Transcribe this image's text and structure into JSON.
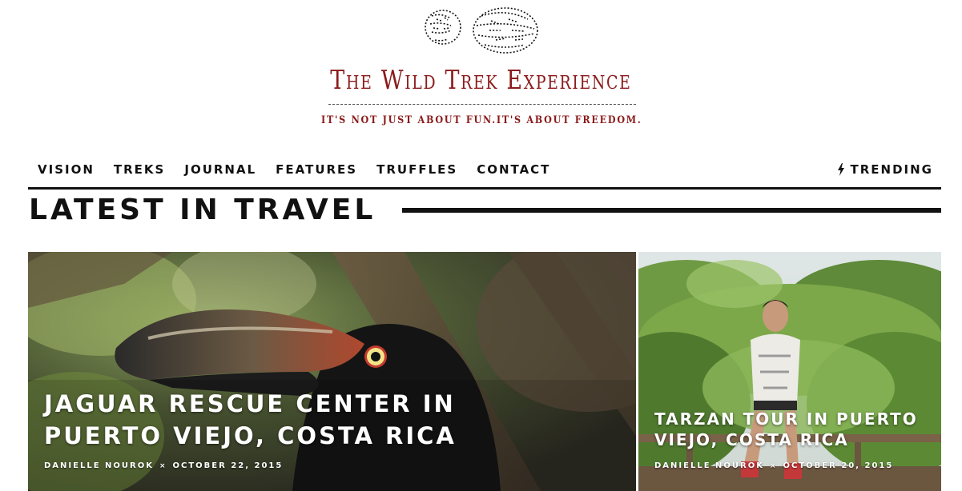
{
  "site": {
    "title": "The Wild Trek Experience",
    "tagline": "it's not just about fun.it's about freedom."
  },
  "nav": {
    "items": [
      {
        "label": "VISION"
      },
      {
        "label": "TREKS"
      },
      {
        "label": "JOURNAL"
      },
      {
        "label": "FEATURES"
      },
      {
        "label": "TRUFFLES"
      },
      {
        "label": "CONTACT"
      }
    ],
    "trending": {
      "label": "TRENDING",
      "icon": "bolt-icon"
    }
  },
  "section": {
    "title": "LATEST IN TRAVEL"
  },
  "posts": [
    {
      "title": "JAGUAR RESCUE CENTER IN PUERTO VIEJO, COSTA RICA",
      "author": "DANIELLE NOUROK",
      "separator": "×",
      "date": "OCTOBER 22, 2015",
      "image": "toucan photo"
    },
    {
      "title": "TARZAN TOUR IN PUERTO VIEJO, COSTA RICA",
      "author": "DANIELLE NOUROK",
      "separator": "×",
      "date": "OCTOBER 20, 2015",
      "image": "jungle zipline photo"
    }
  ],
  "colors": {
    "brand": "#8b1a1a",
    "text": "#111111",
    "background": "#ffffff"
  }
}
